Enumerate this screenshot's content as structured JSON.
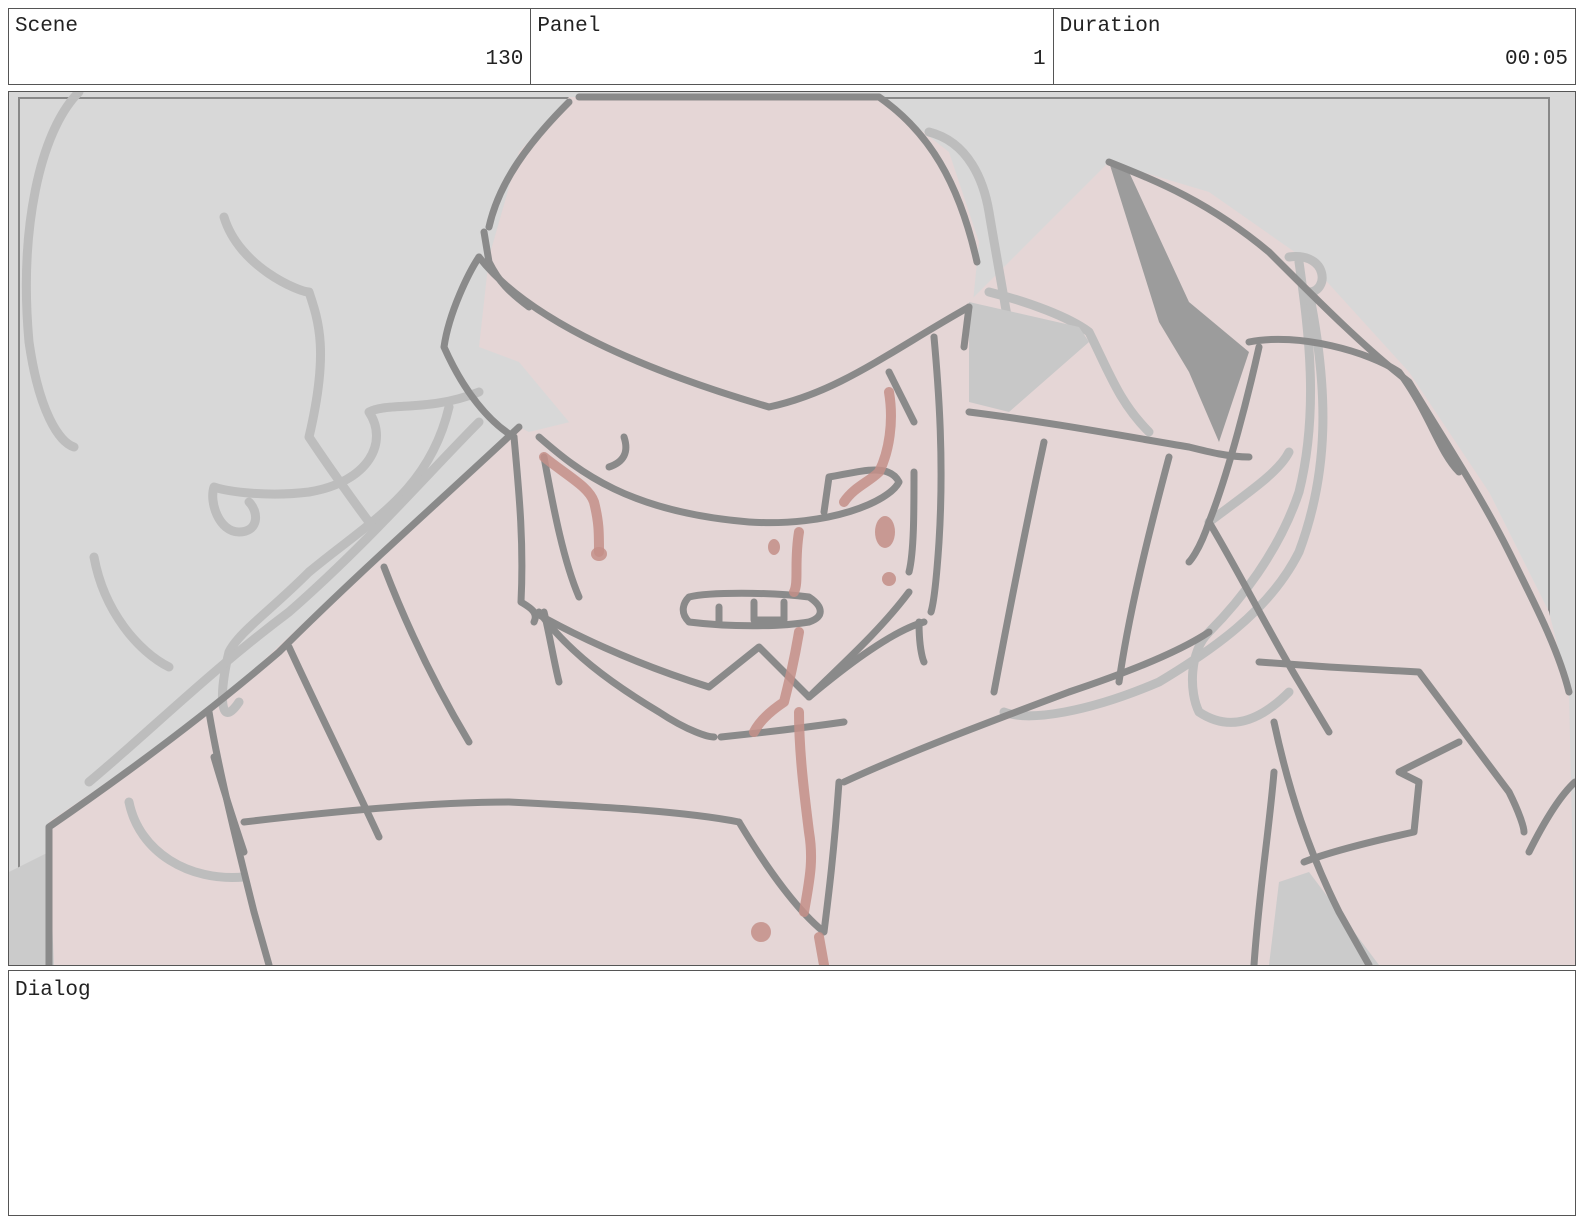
{
  "header": {
    "scene": {
      "label": "Scene",
      "value": "130"
    },
    "panel": {
      "label": "Panel",
      "value": "1"
    },
    "duration": {
      "label": "Duration",
      "value": "00:05"
    }
  },
  "panel_image": {
    "background_color": "#d8d8d8",
    "figure_fill_color": "#e5d6d6",
    "line_color": "#8a8a8a",
    "blood_color": "#c48f88"
  },
  "dialog": {
    "label": "Dialog",
    "text": ""
  }
}
